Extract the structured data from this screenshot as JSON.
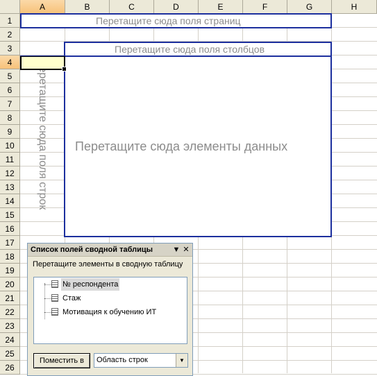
{
  "columns": [
    "A",
    "B",
    "C",
    "D",
    "E",
    "F",
    "G",
    "H"
  ],
  "rows": [
    "1",
    "2",
    "3",
    "4",
    "5",
    "6",
    "7",
    "8",
    "9",
    "10",
    "11",
    "12",
    "13",
    "14",
    "15",
    "16",
    "17",
    "18",
    "19",
    "20",
    "21",
    "22",
    "23",
    "24",
    "25",
    "26"
  ],
  "pivot": {
    "page_zone": "Перетащите сюда поля страниц",
    "column_zone": "Перетащите сюда поля столбцов",
    "row_zone": "Перетащите сюда поля строк",
    "data_zone": "Перетащите сюда элементы данных"
  },
  "pane": {
    "title": "Список полей сводной таблицы",
    "instruction": "Перетащите элементы в сводную таблицу",
    "fields": [
      {
        "label": "№ респондента"
      },
      {
        "label": "Стаж"
      },
      {
        "label": "Мотивация к обучению ИТ"
      }
    ],
    "place_button": "Поместить в",
    "area_value": "Область строк",
    "dropdown_glyph": "▼",
    "close_glyph": "✕"
  }
}
